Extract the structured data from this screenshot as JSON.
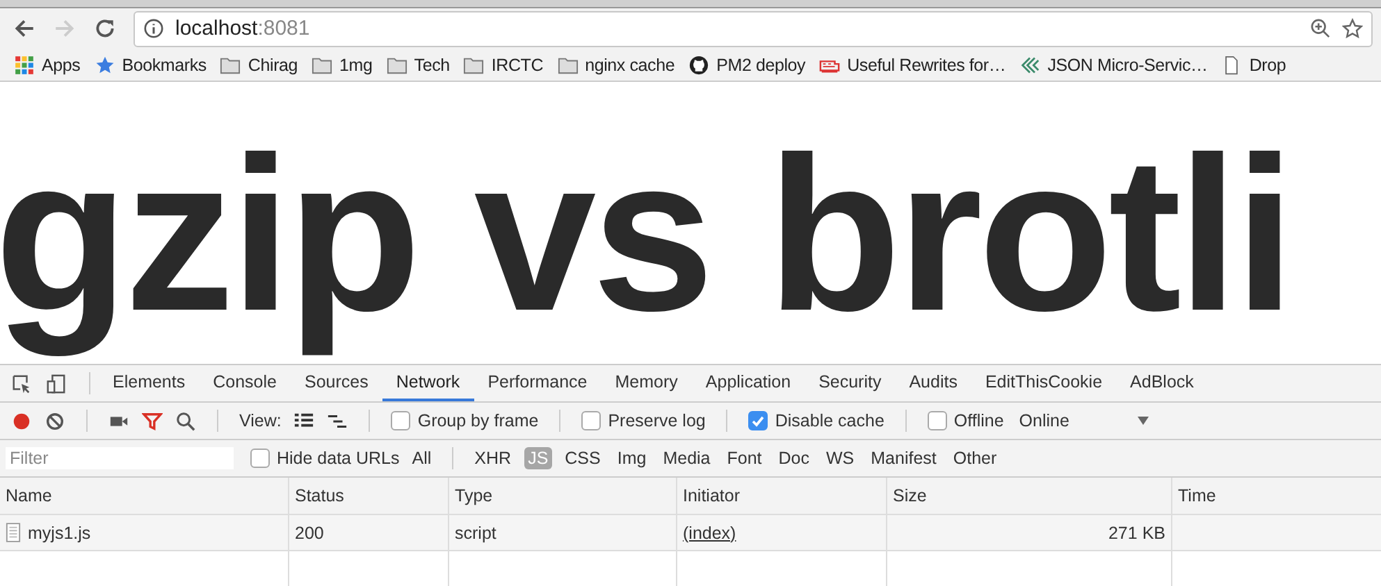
{
  "address": {
    "host": "localhost",
    "port": ":8081"
  },
  "bookmarks": [
    {
      "label": "Apps",
      "kind": "apps"
    },
    {
      "label": "Bookmarks",
      "kind": "star"
    },
    {
      "label": "Chirag",
      "kind": "folder"
    },
    {
      "label": "1mg",
      "kind": "folder"
    },
    {
      "label": "Tech",
      "kind": "folder"
    },
    {
      "label": "IRCTC",
      "kind": "folder"
    },
    {
      "label": "nginx cache",
      "kind": "folder"
    },
    {
      "label": "PM2 deploy",
      "kind": "github"
    },
    {
      "label": "Useful Rewrites for…",
      "kind": "train"
    },
    {
      "label": "JSON Micro-Servic…",
      "kind": "chevrons"
    },
    {
      "label": "Drop",
      "kind": "page"
    }
  ],
  "heading": "gzip vs brotli",
  "devtools": {
    "tabs": [
      {
        "label": "Elements",
        "selected": false
      },
      {
        "label": "Console",
        "selected": false
      },
      {
        "label": "Sources",
        "selected": false
      },
      {
        "label": "Network",
        "selected": true
      },
      {
        "label": "Performance",
        "selected": false
      },
      {
        "label": "Memory",
        "selected": false
      },
      {
        "label": "Application",
        "selected": false
      },
      {
        "label": "Security",
        "selected": false
      },
      {
        "label": "Audits",
        "selected": false
      },
      {
        "label": "EditThisCookie",
        "selected": false
      },
      {
        "label": "AdBlock",
        "selected": false
      }
    ],
    "view_label": "View:",
    "options": [
      {
        "label": "Group by frame",
        "checked": false
      },
      {
        "label": "Preserve log",
        "checked": false
      },
      {
        "label": "Disable cache",
        "checked": true
      },
      {
        "label": "Offline",
        "checked": false
      }
    ],
    "throttling": "Online",
    "filter": {
      "placeholder": "Filter"
    },
    "hide_data_urls": {
      "label": "Hide data URLs",
      "checked": false
    },
    "types": [
      {
        "label": "All",
        "selected": false
      },
      {
        "label": "XHR",
        "selected": false
      },
      {
        "label": "JS",
        "selected": true
      },
      {
        "label": "CSS",
        "selected": false
      },
      {
        "label": "Img",
        "selected": false
      },
      {
        "label": "Media",
        "selected": false
      },
      {
        "label": "Font",
        "selected": false
      },
      {
        "label": "Doc",
        "selected": false
      },
      {
        "label": "WS",
        "selected": false
      },
      {
        "label": "Manifest",
        "selected": false
      },
      {
        "label": "Other",
        "selected": false
      }
    ],
    "table": {
      "columns": [
        "Name",
        "Status",
        "Type",
        "Initiator",
        "Size",
        "Time"
      ],
      "rows": [
        {
          "name": "myjs1.js",
          "status": "200",
          "type": "script",
          "initiator": "(index)",
          "size": "271 KB"
        }
      ]
    }
  }
}
